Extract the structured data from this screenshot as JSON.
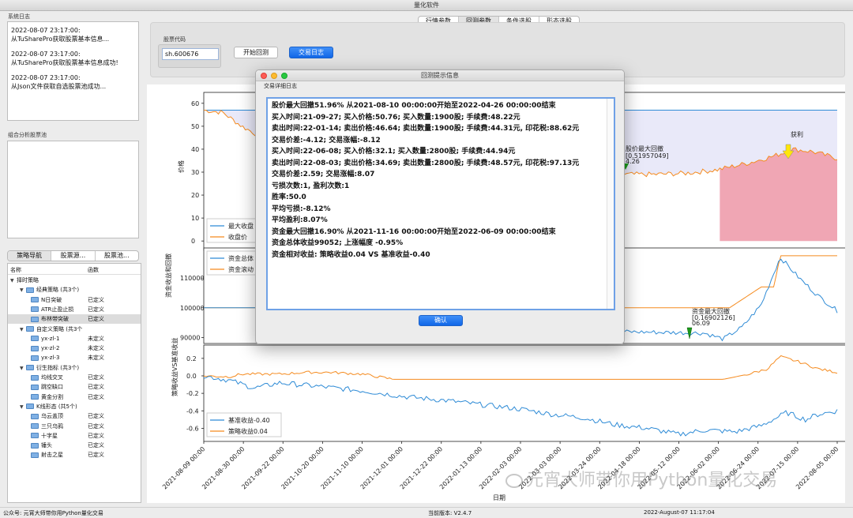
{
  "window": {
    "title": "量化软件"
  },
  "left": {
    "system_log_label": "系统日志",
    "log_entries": [
      {
        "time": "2022-08-07 23:17:00:",
        "msg": "从TuSharePro获取股票基本信息..."
      },
      {
        "time": "2022-08-07 23:17:00:",
        "msg": "从TuSharePro获取股票基本信息成功!"
      },
      {
        "time": "2022-08-07 23:17:00:",
        "msg": "从Json文件获取自选股票池成功..."
      }
    ],
    "combo_pool_label": "组合分析股票池",
    "nav_tabs": [
      "策略导航",
      "股票源...",
      "股票池..."
    ],
    "tree_headers": [
      "名称",
      "函数"
    ],
    "tree": [
      {
        "label": "择时策略",
        "status": "",
        "level": 0,
        "folder": false
      },
      {
        "label": "经典策略 (共3个)",
        "status": "",
        "level": 1,
        "folder": true
      },
      {
        "label": "N日突破",
        "status": "已定义",
        "level": 2,
        "folder": true
      },
      {
        "label": "ATR止盈止损",
        "status": "已定义",
        "level": 2,
        "folder": true
      },
      {
        "label": "布林带突破",
        "status": "已定义",
        "level": 2,
        "folder": true,
        "selected": true
      },
      {
        "label": "自定义策略 (共3个",
        "status": "",
        "level": 1,
        "folder": true
      },
      {
        "label": "yx-zl-1",
        "status": "未定义",
        "level": 2,
        "folder": true
      },
      {
        "label": "yx-zl-2",
        "status": "未定义",
        "level": 2,
        "folder": true
      },
      {
        "label": "yx-zl-3",
        "status": "未定义",
        "level": 2,
        "folder": true
      },
      {
        "label": "衍生指标 (共3个)",
        "status": "",
        "level": 1,
        "folder": true
      },
      {
        "label": "均线交叉",
        "status": "已定义",
        "level": 2,
        "folder": true
      },
      {
        "label": "跳空缺口",
        "status": "已定义",
        "level": 2,
        "folder": true
      },
      {
        "label": "黄金分割",
        "status": "已定义",
        "level": 2,
        "folder": true
      },
      {
        "label": "K线形态 (共5个)",
        "status": "",
        "level": 1,
        "folder": true
      },
      {
        "label": "乌云盖顶",
        "status": "已定义",
        "level": 2,
        "folder": true
      },
      {
        "label": "三只乌鸦",
        "status": "已定义",
        "level": 2,
        "folder": true
      },
      {
        "label": "十字星",
        "status": "已定义",
        "level": 2,
        "folder": true
      },
      {
        "label": "锤头",
        "status": "已定义",
        "level": 2,
        "folder": true
      },
      {
        "label": "射击之星",
        "status": "已定义",
        "level": 2,
        "folder": true
      }
    ]
  },
  "top_tabs": [
    "行情参数",
    "回测参数",
    "条件选股",
    "形态选股"
  ],
  "active_top_tab": 1,
  "controls": {
    "stock_code_label": "股票代码",
    "stock_code_value": "sh.600676",
    "start_button": "开始回测",
    "log_button": "交易日志"
  },
  "modal": {
    "title": "回测提示信息",
    "subtitle": "交易详细日志",
    "lines": [
      "股价最大回撤51.96% 从2021-08-10 00:00:00开始至2022-04-26 00:00:00结束",
      "买入时间:21-09-27; 买入价格:50.76; 买入数量:1900股; 手续费:48.22元",
      "卖出时间:22-01-14; 卖出价格:46.64; 卖出数量:1900股; 手续费:44.31元, 印花税:88.62元",
      "交易价差:-4.12; 交易涨幅:-8.12",
      "买入时间:22-06-08; 买入价格:32.1; 买入数量:2800股; 手续费:44.94元",
      "卖出时间:22-08-03; 卖出价格:34.69; 卖出数量:2800股; 手续费:48.57元, 印花税:97.13元",
      "交易价差:2.59; 交易涨幅:8.07",
      "亏损次数:1, 盈利次数:1",
      "胜率:50.0",
      "平均亏损:-8.12%",
      "平均盈利:8.07%",
      "资金最大回撤16.90% 从2021-11-16 00:00:00开始至2022-06-09 00:00:00结束",
      "资金总体收益99052; 上涨幅度 -0.95%",
      "资金相对收益: 策略收益0.04 VS 基准收益-0.40"
    ],
    "confirm_button": "确认"
  },
  "chart_data": [
    {
      "type": "area",
      "ylabel": "价格",
      "yticks": [
        0,
        10,
        20,
        30,
        40,
        50,
        60
      ],
      "ylim": [
        -2,
        62
      ],
      "legend": [
        "最大收盘",
        "收盘价"
      ],
      "annotations": [
        {
          "text": "股价最大回撤",
          "sub": "[0.51957049]",
          "sub2": "4.26"
        },
        {
          "text": "获利"
        }
      ],
      "colors": {
        "close": "#f58b1f",
        "max": "#2e8bd6",
        "drawdown_fill": "#e9e9f9",
        "profit_fill": "#f0a6b4"
      }
    },
    {
      "type": "line",
      "ylabel": "资金收益和回撤",
      "yticks": [
        90000,
        100000,
        110000
      ],
      "ylim": [
        88000,
        118000
      ],
      "legend": [
        "资金总体",
        "资金滚动"
      ],
      "annotations": [
        {
          "text": "资金最大回撤",
          "sub": "[0.16902126]",
          "sub2": "06.09"
        }
      ],
      "colors": {
        "total": "#2e8bd6",
        "rolling": "#f58b1f"
      }
    },
    {
      "type": "line",
      "ylabel": "策略收益VS基准收益",
      "yticks": [
        0.2,
        0.0,
        -0.2,
        -0.4,
        -0.6
      ],
      "ylim": [
        -0.75,
        0.28
      ],
      "legend": [
        "基准收益-0.40",
        "策略收益0.04"
      ],
      "colors": {
        "benchmark": "#2e8bd6",
        "strategy": "#f58b1f"
      }
    }
  ],
  "x_axis": {
    "label": "日期",
    "ticks": [
      "2021-08-09 00:00",
      "2021-08-30 00:00",
      "2021-09-22 00:00",
      "2021-10-20 00:00",
      "2021-11-10 00:00",
      "2021-12-01 00:00",
      "2021-12-22 00:00",
      "2022-01-13 00:00",
      "2022-02-03 00:00",
      "2022-03-03 00:00",
      "2022-03-24 00:00",
      "2022-04-18 00:00",
      "2022-05-12 00:00",
      "2022-06-02 00:00",
      "2022-06-24 00:00",
      "2022-07-15 00:00",
      "2022-08-05 00:00"
    ]
  },
  "watermark": "元宵大师带你用Python量化交易",
  "status": {
    "left": "公众号: 元宵大师带你用Python量化交易",
    "version": "当前版本: V2.4.7",
    "datetime": "2022-August-07 11:17:04"
  }
}
